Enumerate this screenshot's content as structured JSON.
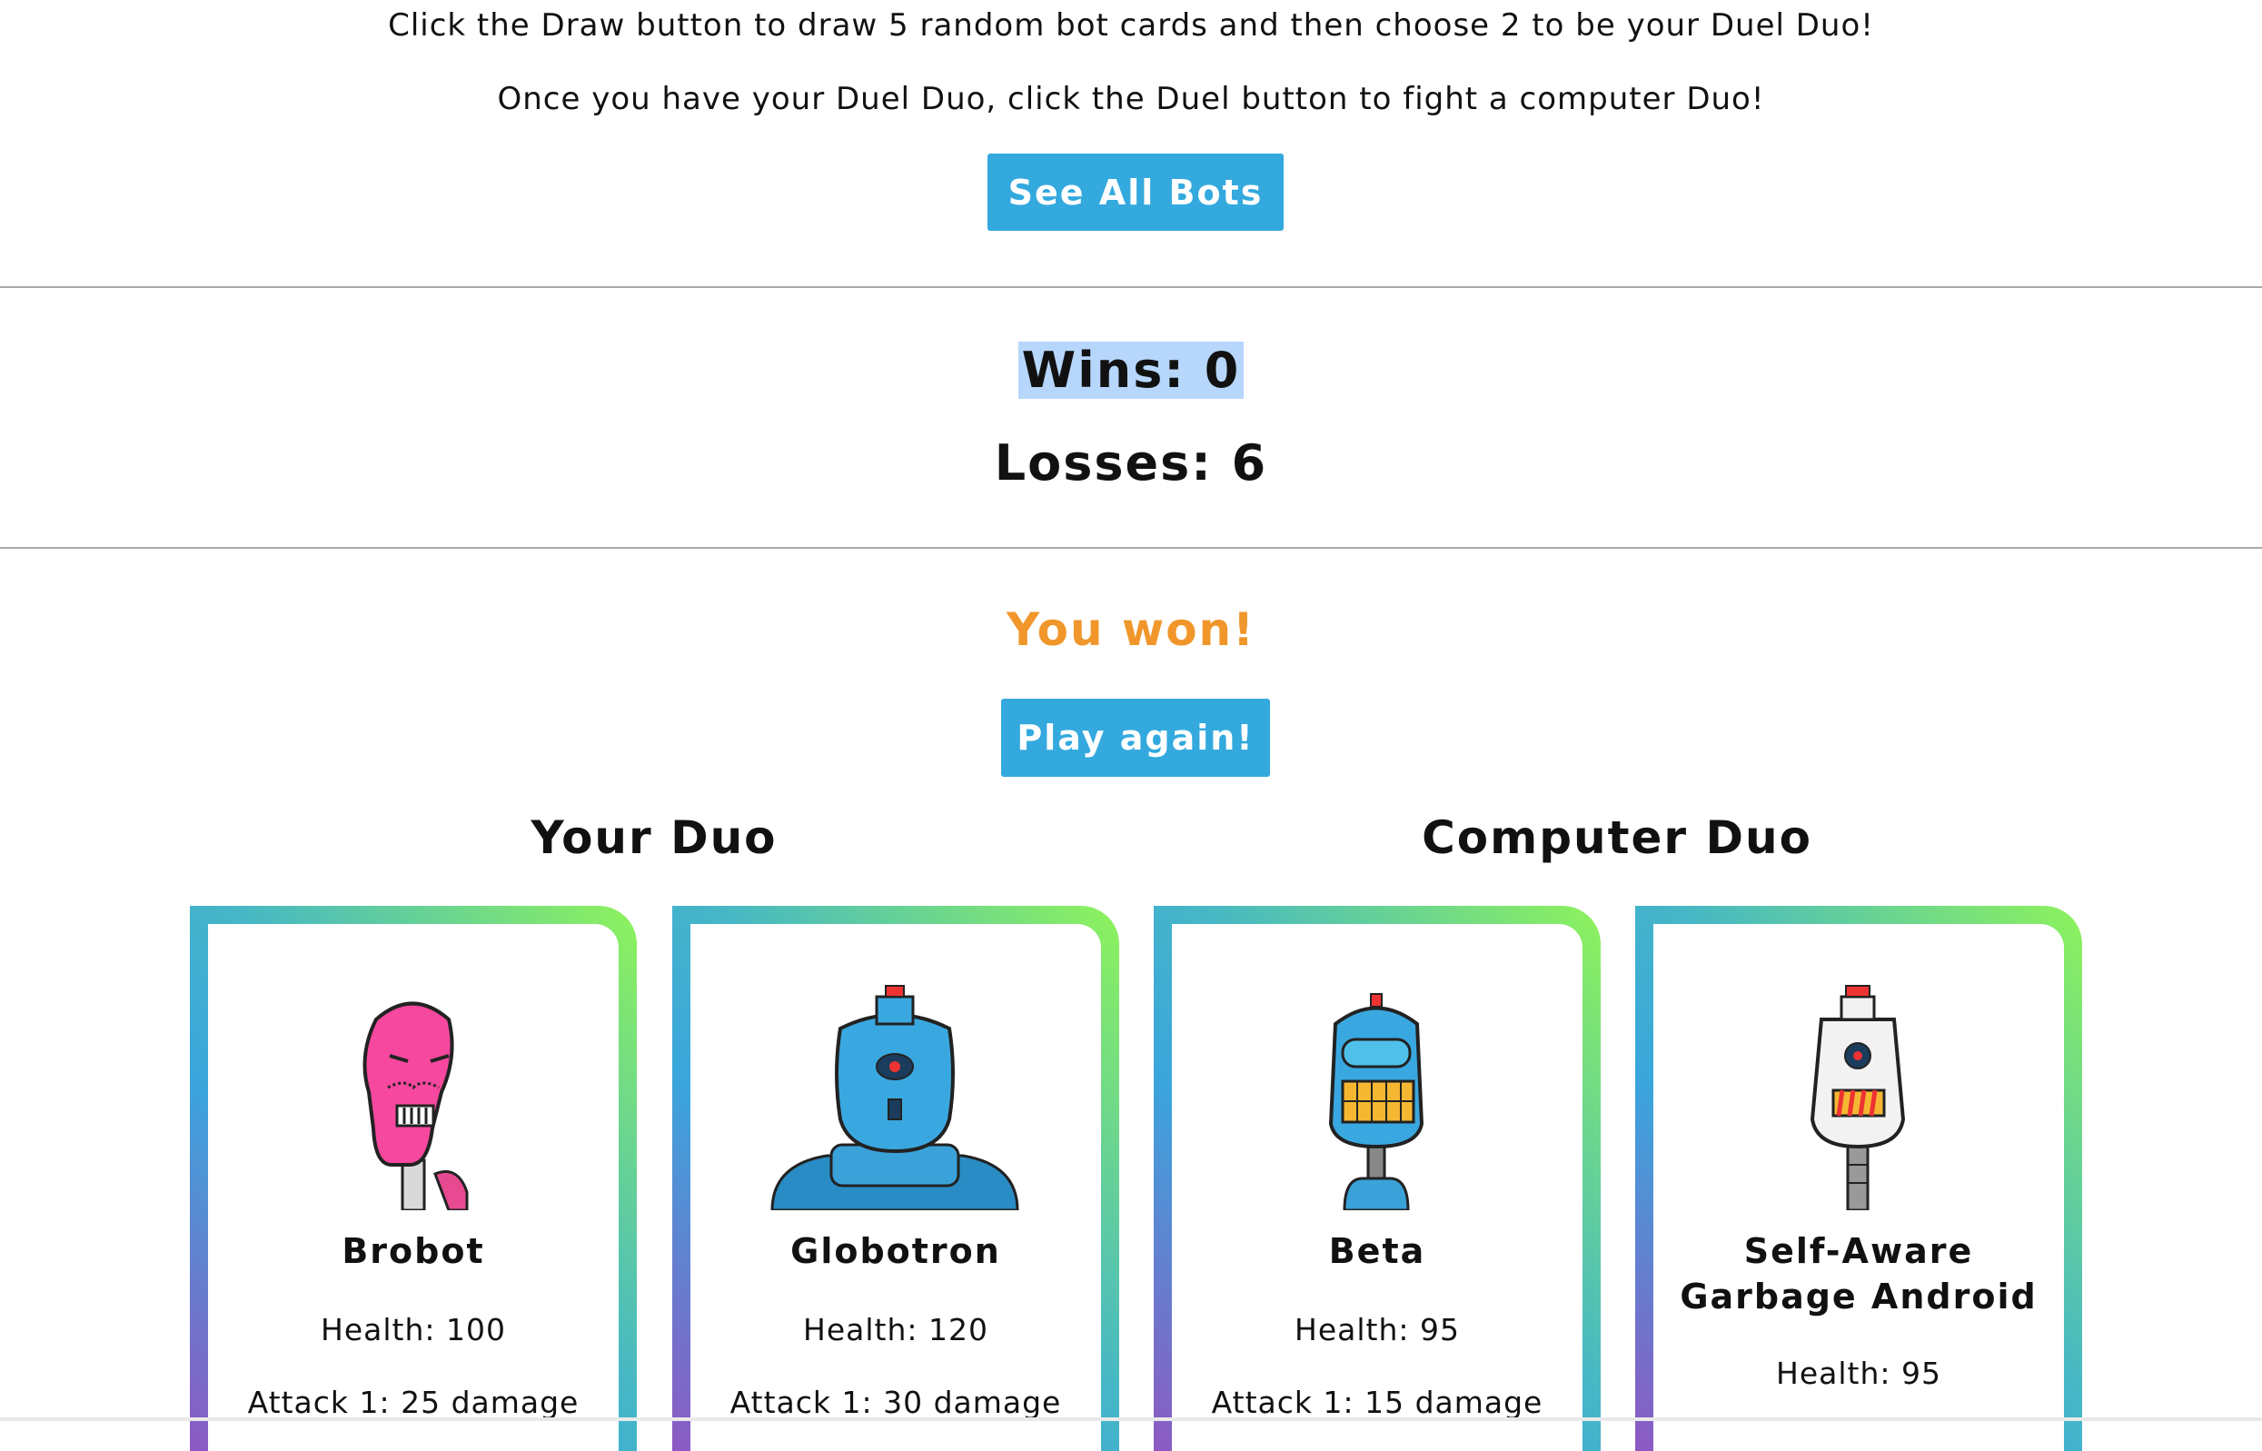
{
  "intro": {
    "line1": "Click the Draw button to draw 5 random bot cards and then choose 2 to be your Duel Duo!",
    "line2": "Once you have your Duel Duo, click the Duel button to fight a computer Duo!"
  },
  "see_all_label": "See All Bots",
  "score": {
    "wins": "Wins: 0",
    "losses": "Losses: 6"
  },
  "result": {
    "message": "You won!",
    "play_again_label": "Play again!"
  },
  "player_duo": {
    "title": "Your Duo",
    "cards": [
      {
        "name": "Brobot",
        "health": "Health: 100",
        "attack": "Attack 1: 25 damage"
      },
      {
        "name": "Globotron",
        "health": "Health: 120",
        "attack": "Attack 1: 30 damage"
      }
    ]
  },
  "computer_duo": {
    "title": "Computer Duo",
    "cards": [
      {
        "name": "Beta",
        "health": "Health: 95",
        "attack": "Attack 1: 15 damage"
      },
      {
        "name": "Self-Aware Garbage Android",
        "health": "Health: 95"
      }
    ]
  },
  "colors": {
    "button": "#33a9de",
    "result": "#f0962a",
    "highlight": "#b6d7fb"
  }
}
